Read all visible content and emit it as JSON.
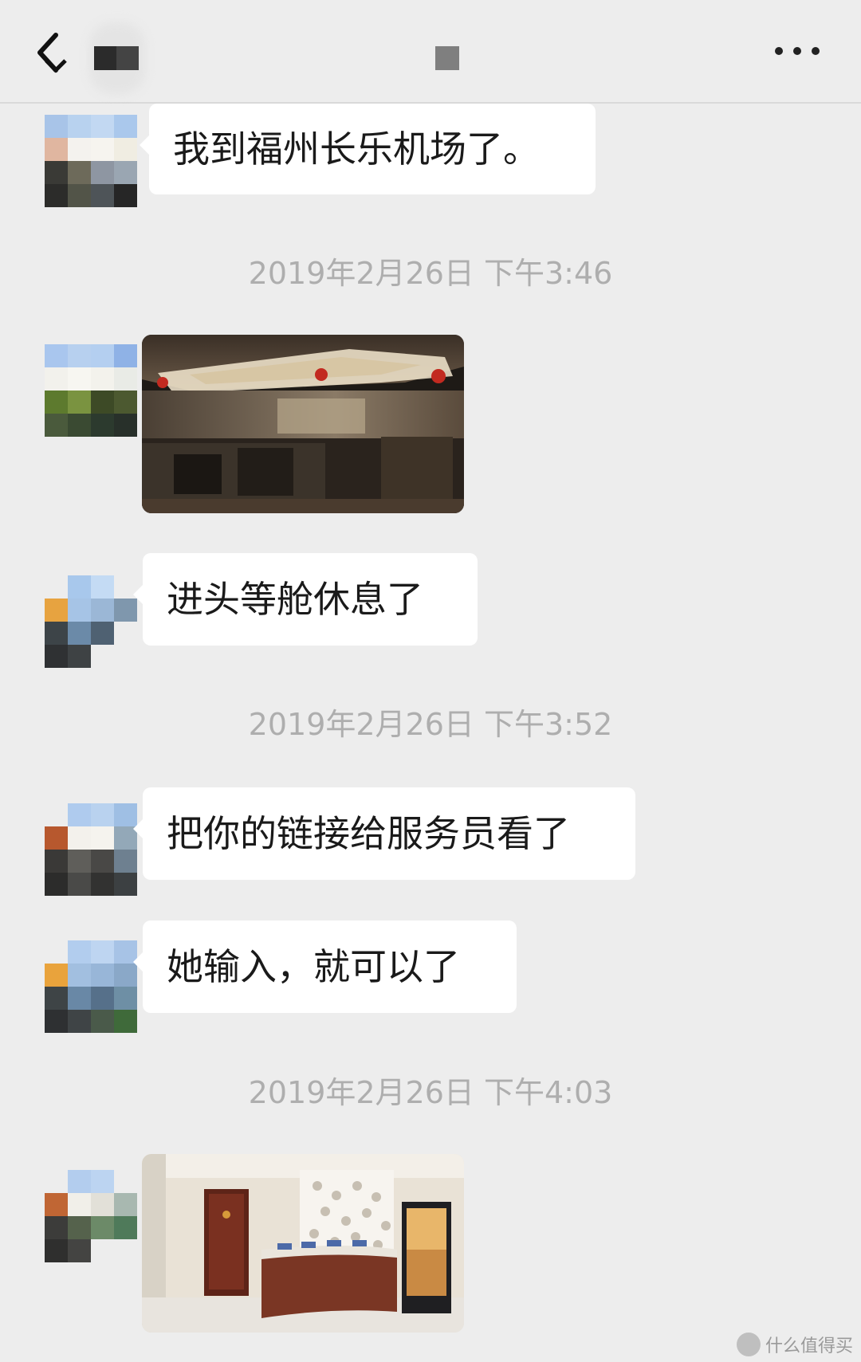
{
  "nav": {
    "back_icon": "chevron-left-icon",
    "more_icon": "ellipsis-icon"
  },
  "messages": [
    {
      "type": "text",
      "text": "我到福州长乐机场了。"
    },
    {
      "type": "timestamp",
      "text": "2019年2月26日 下午3:46"
    },
    {
      "type": "image",
      "description_icon": "photo-lounge-dark"
    },
    {
      "type": "text",
      "text": "进头等舱休息了"
    },
    {
      "type": "timestamp",
      "text": "2019年2月26日 下午3:52"
    },
    {
      "type": "text",
      "text": "把你的链接给服务员看了"
    },
    {
      "type": "text",
      "text": "她输入，就可以了"
    },
    {
      "type": "timestamp",
      "text": "2019年2月26日 下午4:03"
    },
    {
      "type": "image",
      "description_icon": "photo-lounge-buffet"
    }
  ],
  "watermark": {
    "text": "什么值得买"
  },
  "colors": {
    "background": "#ededed",
    "bubble": "#ffffff",
    "timestamp": "#aeaeae",
    "text": "#1a1a1a"
  }
}
